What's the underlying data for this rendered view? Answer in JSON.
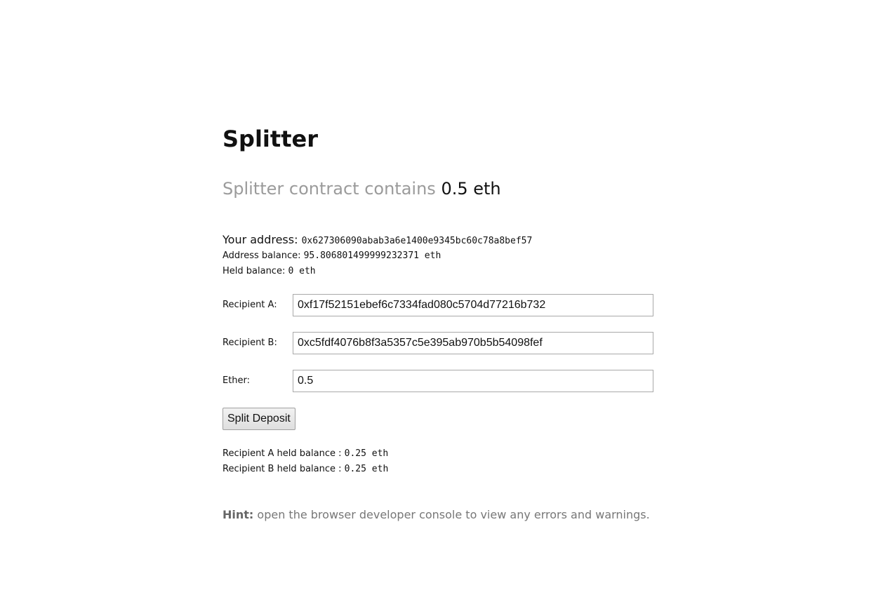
{
  "title": "Splitter",
  "contract": {
    "label": "Splitter contract contains",
    "value": "0.5 eth"
  },
  "account": {
    "address_label": "Your address:",
    "address": "0x627306090abab3a6e1400e9345bc60c78a8bef57",
    "balance_label": "Address balance:",
    "balance": "95.806801499999232371 eth",
    "held_label": "Held balance:",
    "held": "0 eth"
  },
  "form": {
    "recipient_a_label": "Recipient A:",
    "recipient_a_value": "0xf17f52151ebef6c7334fad080c5704d77216b732",
    "recipient_b_label": "Recipient B:",
    "recipient_b_value": "0xc5fdf4076b8f3a5357c5e395ab970b5b54098fef",
    "ether_label": "Ether:",
    "ether_value": "0.5",
    "submit_label": "Split Deposit"
  },
  "results": {
    "recipient_a_held_label": "Recipient A held balance :",
    "recipient_a_held": "0.25 eth",
    "recipient_b_held_label": "Recipient B held balance :",
    "recipient_b_held": "0.25 eth"
  },
  "hint": {
    "prefix": "Hint:",
    "text": "open the browser developer console to view any errors and warnings."
  }
}
